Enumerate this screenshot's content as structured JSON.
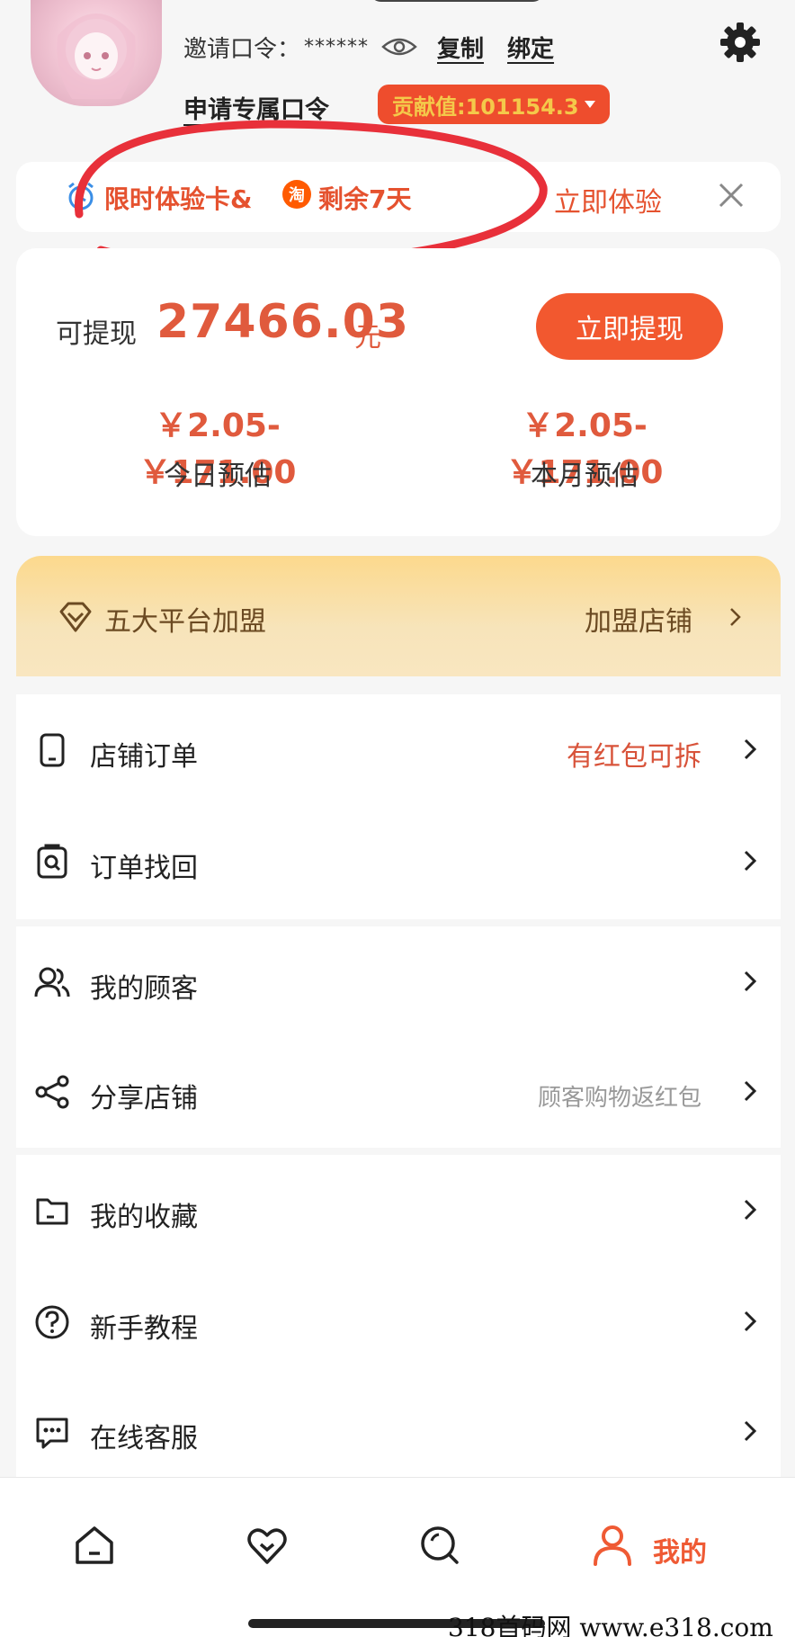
{
  "header": {
    "invite_label": "邀请口令：",
    "invite_code": "******",
    "copy_label": "复制",
    "bind_label": "绑定",
    "apply_label": "申请专属口令",
    "contribution_label": "贡献值:101154.3"
  },
  "trial": {
    "title": "限时体验卡&",
    "platform_badge": "淘",
    "remaining": "剩余7天",
    "action": "立即体验"
  },
  "earnings": {
    "withdraw_label": "可提现",
    "withdraw_amount": "27466.03",
    "withdraw_unit": "元",
    "withdraw_button": "立即提现",
    "today_range": "￥2.05-￥171.00",
    "today_label": "今日预估",
    "month_range": "￥2.05-￥171.00",
    "month_label": "本月预估"
  },
  "franchise": {
    "title": "五大平台加盟",
    "link": "加盟店铺"
  },
  "menu": {
    "store_orders": {
      "label": "店铺订单",
      "hint": "有红包可拆"
    },
    "order_recovery": {
      "label": "订单找回"
    },
    "my_customers": {
      "label": "我的顾客"
    },
    "share_store": {
      "label": "分享店铺",
      "hint": "顾客购物返红包"
    },
    "favorites": {
      "label": "我的收藏"
    },
    "tutorial": {
      "label": "新手教程"
    },
    "support": {
      "label": "在线客服"
    }
  },
  "tabbar": {
    "mine_label": "我的"
  },
  "watermark": "318首码网 www.e318.com",
  "colors": {
    "accent": "#ef5a34",
    "badge": "#ee4d2d",
    "gold": "#f4c94a",
    "franchise_text": "#6b4a22"
  }
}
